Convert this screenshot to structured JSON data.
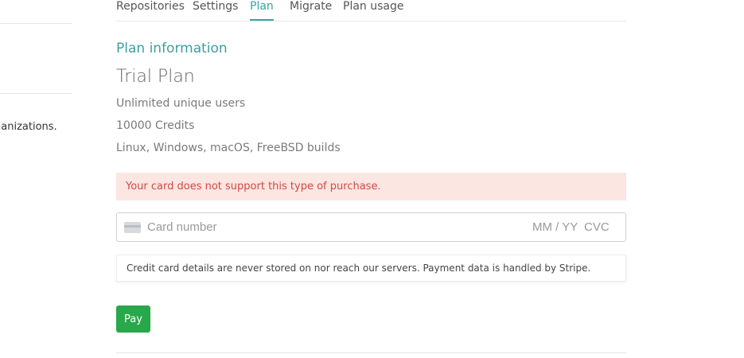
{
  "sidebar": {
    "partial_text": "ganizations."
  },
  "tabs": [
    {
      "label": "Repositories",
      "active": false
    },
    {
      "label": "Settings",
      "active": false
    },
    {
      "label": "Plan",
      "active": true
    },
    {
      "label": "Migrate",
      "active": false
    },
    {
      "label": "Plan usage",
      "active": false
    }
  ],
  "plan": {
    "section_title": "Plan information",
    "name": "Trial Plan",
    "features": [
      "Unlimited unique users",
      "10000 Credits",
      "Linux, Windows, macOS, FreeBSD builds"
    ]
  },
  "error": {
    "message": "Your card does not support this type of purchase."
  },
  "card_form": {
    "card_number_placeholder": "Card number",
    "expiry_placeholder": "MM / YY",
    "cvc_placeholder": "CVC",
    "icon": "credit-card-icon"
  },
  "info": {
    "message": "Credit card details are never stored on nor reach our servers. Payment data is handled by Stripe."
  },
  "pay_button": {
    "label": "Pay"
  },
  "colors": {
    "accent": "#3aa3a3",
    "error_bg": "#fbe6e1",
    "error_text": "#d14848",
    "pay_button": "#28a84a"
  }
}
